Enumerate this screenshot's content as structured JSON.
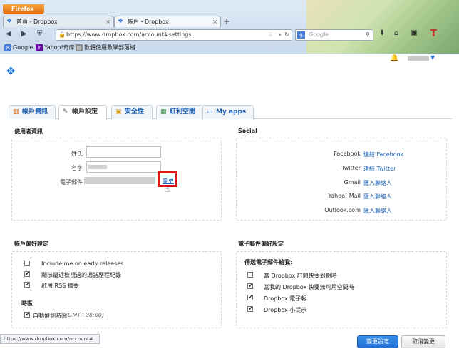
{
  "browser": {
    "menu_label": "Firefox",
    "tabs": [
      {
        "icon": "dropbox-icon",
        "label": "首頁 - Dropbox",
        "close": "×"
      },
      {
        "icon": "dropbox-icon",
        "label": "帳戶 - Dropbox",
        "close": "×"
      }
    ],
    "new_tab": "+",
    "url": "https://www.dropbox.com/account#settings",
    "search_placeholder": "Google",
    "search_engine_glyph": "g",
    "bookmarks": [
      {
        "label": "Google",
        "icon": "google-icon"
      },
      {
        "label": "Yahoo!奇摩",
        "icon": "yahoo-icon"
      },
      {
        "label": "數體使用數學部落格",
        "icon": "blog-icon"
      }
    ]
  },
  "page": {
    "tabs": [
      {
        "label": "帳戶資訊",
        "icon": "bar-chart-icon"
      },
      {
        "label": "帳戶設定",
        "icon": "wrench-icon"
      },
      {
        "label": "安全性",
        "icon": "lock-icon"
      },
      {
        "label": "紅利空間",
        "icon": "gift-icon"
      },
      {
        "label": "My apps",
        "icon": "monitor-icon"
      }
    ],
    "user_info": {
      "title": "使用者資訊",
      "name_label": "姓氏",
      "given_label": "名字",
      "email_label": "電子郵件",
      "change_link": "變更"
    },
    "social": {
      "title": "Social",
      "rows": [
        {
          "label": "Facebook",
          "action": "連結 Facebook"
        },
        {
          "label": "Twitter",
          "action": "連結 Twitter"
        },
        {
          "label": "Gmail",
          "action": "匯入聯絡人"
        },
        {
          "label": "Yahoo! Mail",
          "action": "匯入聯絡人"
        },
        {
          "label": "Outlook.com",
          "action": "匯入聯絡人"
        }
      ]
    },
    "account_prefs": {
      "title": "帳戶偏好設定",
      "items": [
        {
          "label": "Include me on early releases",
          "checked": false
        },
        {
          "label": "顯示最近檢視過的通話歷程紀錄",
          "checked": true
        },
        {
          "label": "啟用 RSS 摘要",
          "checked": true
        }
      ],
      "timezone_title": "時區",
      "timezone_label": "自動偵測時區",
      "timezone_value": "(GMT+08:00)",
      "timezone_checked": true
    },
    "email_prefs": {
      "title": "電子郵件偏好設定",
      "subtitle": "傳送電子郵件給我:",
      "items": [
        {
          "label": "當 Dropbox 訂閱快要到期時",
          "checked": false
        },
        {
          "label": "當我的 Dropbox 快要無可用空間時",
          "checked": true
        },
        {
          "label": "Dropbox 電子報",
          "checked": true
        },
        {
          "label": "Dropbox 小提示",
          "checked": true
        }
      ]
    },
    "save_button": "變更設定",
    "cancel_button": "取消變更",
    "status_url": "https://www.dropbox.com/account#",
    "check_glyph": "✔"
  }
}
